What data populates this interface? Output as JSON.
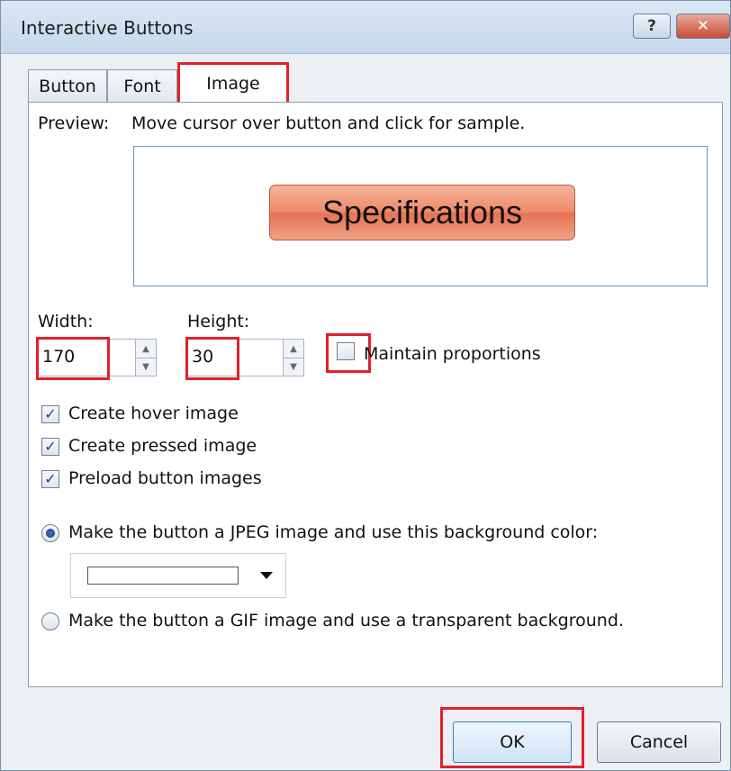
{
  "window": {
    "title": "Interactive Buttons",
    "help_label": "?",
    "close_label": "✕"
  },
  "tabs": [
    {
      "label": "Button",
      "selected": false
    },
    {
      "label": "Font",
      "selected": false
    },
    {
      "label": "Image",
      "selected": true
    }
  ],
  "preview": {
    "label": "Preview:",
    "hint": "Move cursor over button and click for sample.",
    "sample_button_text": "Specifications",
    "sample_button_color": "#ee8a6a"
  },
  "size": {
    "width_label": "Width:",
    "width_value": "170",
    "height_label": "Height:",
    "height_value": "30",
    "maintain_label": "Maintain proportions",
    "maintain_checked": false
  },
  "options": [
    {
      "label": "Create hover image",
      "checked": true
    },
    {
      "label": "Create pressed image",
      "checked": true
    },
    {
      "label": "Preload button images",
      "checked": true
    }
  ],
  "format": {
    "jpeg_label": "Make the button a JPEG image and use this background color:",
    "jpeg_selected": true,
    "background_color": "#ffffff",
    "gif_label": "Make the button a GIF image and use a transparent background.",
    "gif_selected": false
  },
  "footer": {
    "ok_label": "OK",
    "cancel_label": "Cancel"
  },
  "highlight_color": "#e0212b"
}
